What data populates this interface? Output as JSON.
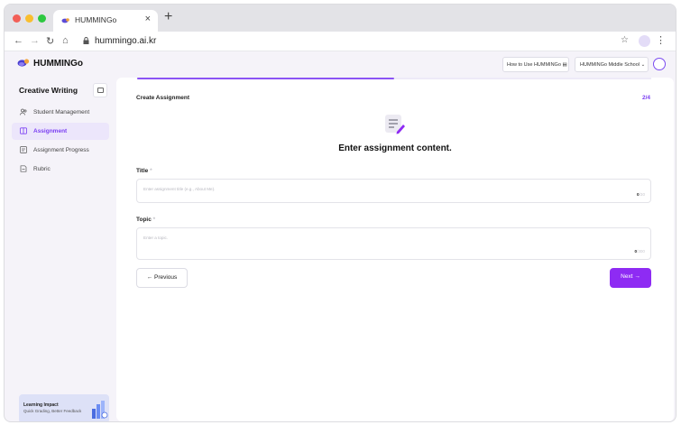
{
  "browser": {
    "tab_title": "HUMMINGo",
    "tab_close": "×",
    "new_tab": "+",
    "url": "hummingo.ai.kr",
    "icons": [
      "back-icon",
      "forward-icon",
      "reload-icon",
      "home-icon",
      "lock-icon",
      "star-icon",
      "kebab-icon"
    ]
  },
  "header": {
    "brand": "HUMMINGo",
    "how_to": "How to Use HUMMINGo",
    "school": "HUMMINGo Middle School"
  },
  "sidebar": {
    "title": "Creative Writing",
    "items": [
      {
        "label": "Student Management",
        "icon": "users-icon"
      },
      {
        "label": "Assignment",
        "icon": "assignment-icon",
        "active": true
      },
      {
        "label": "Assignment Progress",
        "icon": "progress-icon"
      },
      {
        "label": "Rubric",
        "icon": "rubric-icon"
      }
    ],
    "promo": {
      "title": "Learning Impact",
      "subtitle": "Quick Grading, Better Feedback"
    }
  },
  "main": {
    "progress": 0.5,
    "breadcrumb": "Create Assignment",
    "step": "2/4",
    "heading": "Enter assignment content.",
    "title_field": {
      "label": "Title",
      "required_mark": "*",
      "placeholder": "Enter assignment title (e.g., About Me).",
      "count": "0",
      "max": "/30"
    },
    "topic_field": {
      "label": "Topic",
      "required_mark": "*",
      "placeholder": "Enter a topic.",
      "count": "0",
      "max": "/300"
    },
    "prev_label": "← Previous",
    "next_label": "Next →"
  },
  "colors": {
    "accent": "#8e2bf3",
    "accent_light": "#ece6fb",
    "background": "#f5f3f9"
  }
}
